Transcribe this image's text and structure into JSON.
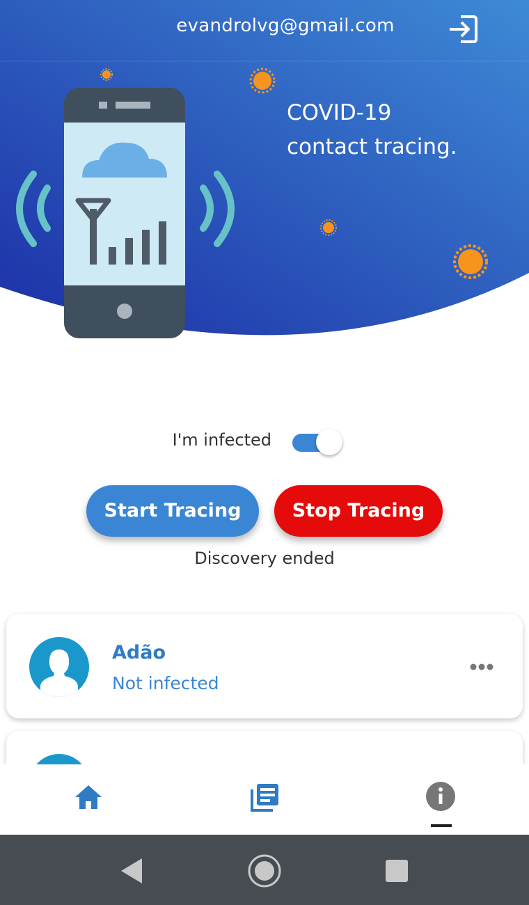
{
  "header": {
    "email": "evandrolvg@gmail.com",
    "logout_icon": "logout-icon",
    "title_line1": "COVID-19",
    "title_line2": "contact tracing."
  },
  "infected_toggle": {
    "label": "I'm infected",
    "on": true
  },
  "actions": {
    "start_label": "Start Tracing",
    "stop_label": "Stop Tracing",
    "status": "Discovery ended"
  },
  "contacts": [
    {
      "name": "Adão",
      "status": "Not infected"
    }
  ],
  "bottom_nav": {
    "items": [
      {
        "icon": "home-icon",
        "active": false
      },
      {
        "icon": "list-icon",
        "active": false
      },
      {
        "icon": "info-icon",
        "active": true
      }
    ]
  },
  "system_nav": {
    "items": [
      "back-icon",
      "home-circle-icon",
      "recent-apps-icon"
    ]
  },
  "colors": {
    "hero_gradient_start": "#1c2fa6",
    "hero_gradient_end": "#3e8ad6",
    "primary": "#3a86d4",
    "stop": "#e50b0b",
    "avatar": "#1a98cc",
    "virus": "#f7941d",
    "system_bar": "#474c52"
  }
}
